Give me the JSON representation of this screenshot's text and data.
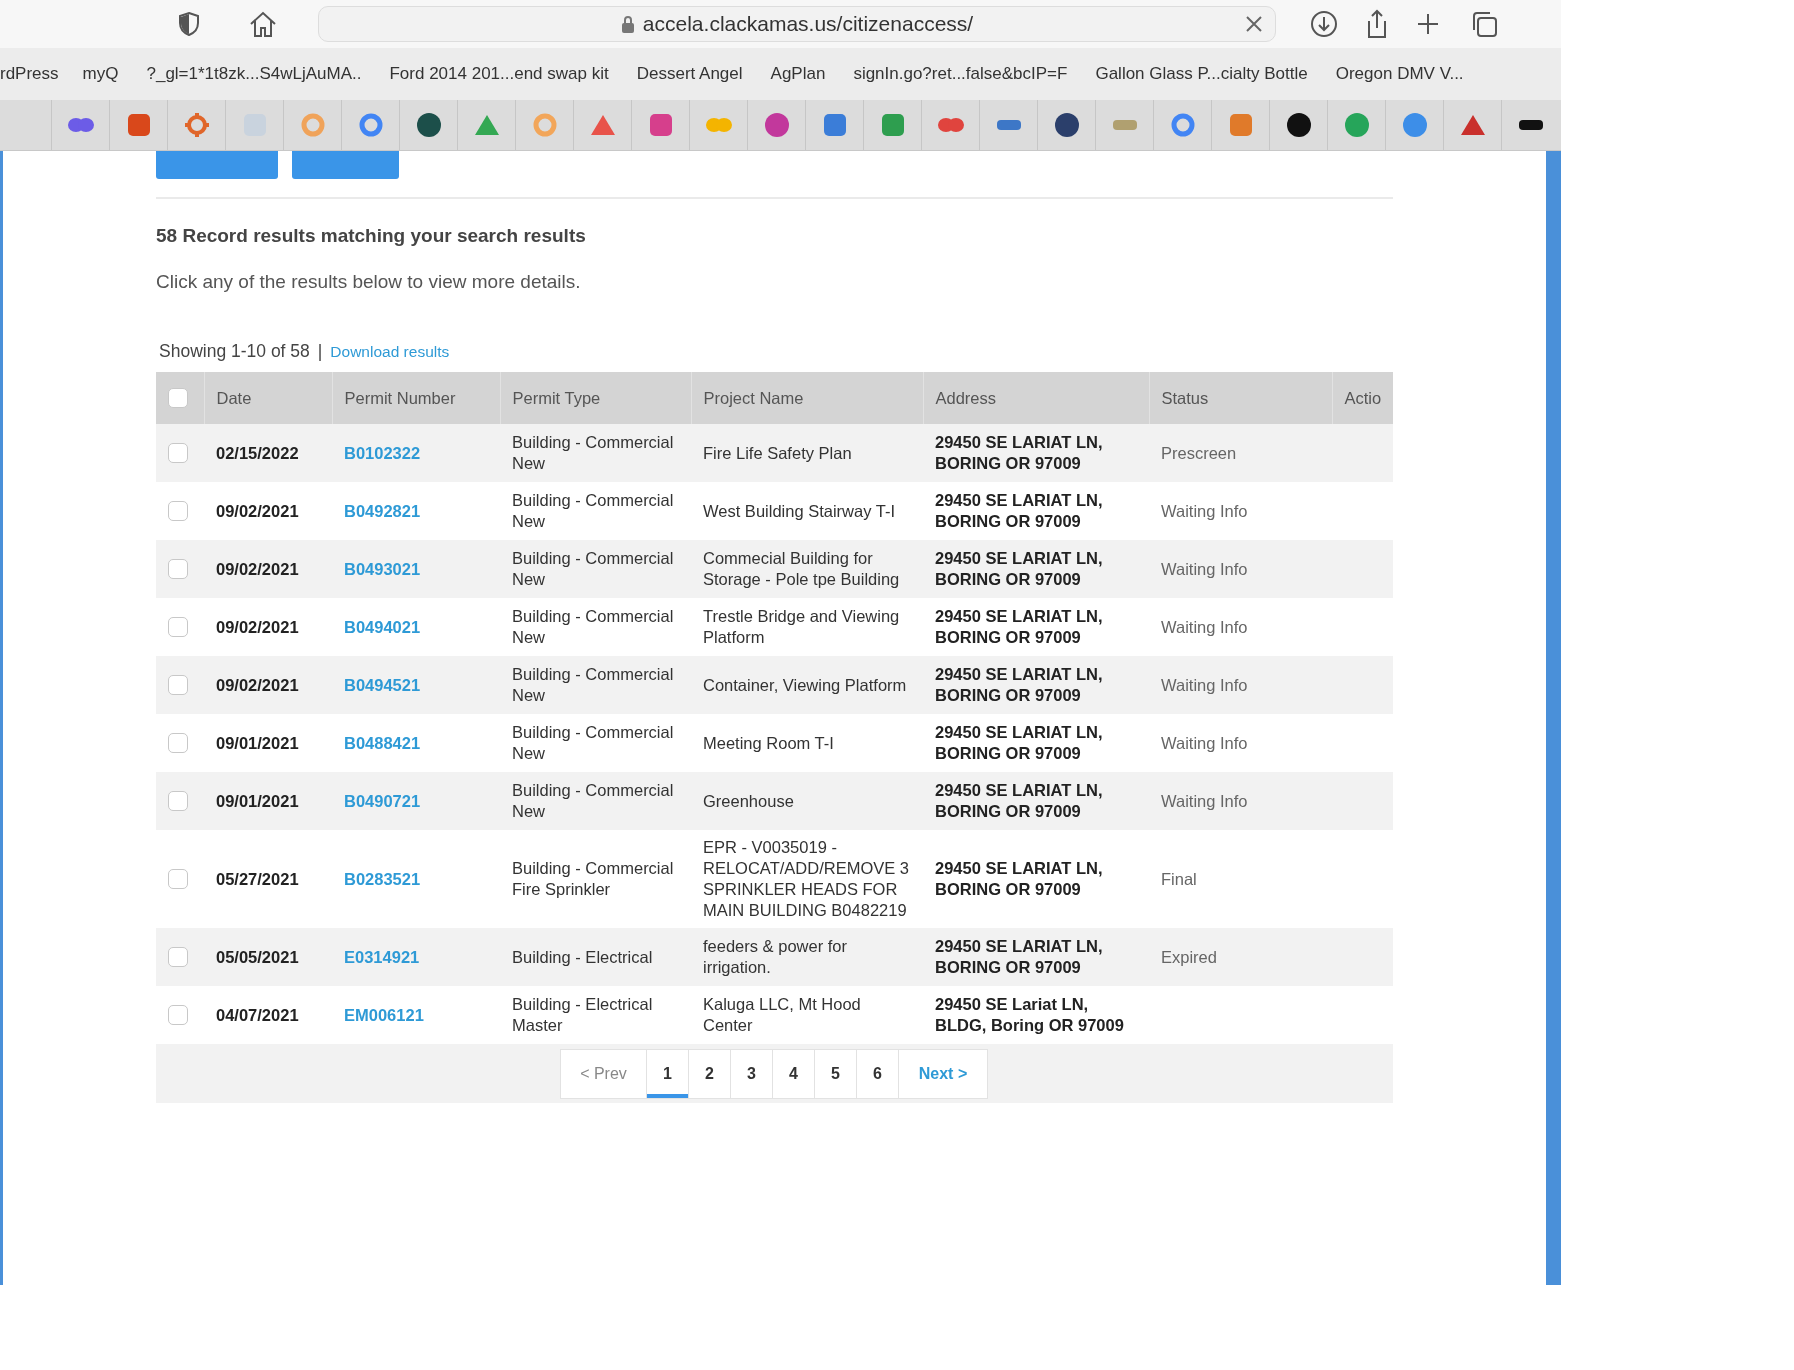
{
  "browser": {
    "url": "accela.clackamas.us/citizenaccess/",
    "bookmarks": [
      "rdPress",
      "myQ",
      "?_gl=1*1t8zk...S4wLjAuMA..",
      "Ford 2014 201...end swap kit",
      "Dessert Angel",
      "AgPlan",
      "signIn.go?ret...false&bcIP=F",
      "Gallon Glass P...cialty Bottle",
      "Oregon DMV V..."
    ]
  },
  "results": {
    "summary": "58 Record results matching your search results",
    "hint": "Click any of the results below to view more details.",
    "showing": "Showing 1-10 of 58",
    "separator": "|",
    "download_link": "Download results"
  },
  "table": {
    "select_all_checked": false,
    "columns": [
      "Date",
      "Permit Number",
      "Permit Type",
      "Project Name",
      "Address",
      "Status",
      "Actio"
    ],
    "rows": [
      {
        "checked": false,
        "date": "02/15/2022",
        "permit_number": "B0102322",
        "permit_type": "Building - Commercial New",
        "project_name": "Fire Life Safety Plan",
        "address": "29450 SE LARIAT LN, BORING OR 97009",
        "status": "Prescreen"
      },
      {
        "checked": false,
        "date": "09/02/2021",
        "permit_number": "B0492821",
        "permit_type": "Building - Commercial New",
        "project_name": "West Building Stairway T-I",
        "address": "29450 SE LARIAT LN, BORING OR 97009",
        "status": "Waiting Info"
      },
      {
        "checked": false,
        "date": "09/02/2021",
        "permit_number": "B0493021",
        "permit_type": "Building - Commercial New",
        "project_name": "Commecial Building for Storage - Pole tpe Building",
        "address": "29450 SE LARIAT LN, BORING OR 97009",
        "status": "Waiting Info"
      },
      {
        "checked": false,
        "date": "09/02/2021",
        "permit_number": "B0494021",
        "permit_type": "Building - Commercial New",
        "project_name": "Trestle Bridge and Viewing Platform",
        "address": "29450 SE LARIAT LN, BORING OR 97009",
        "status": "Waiting Info"
      },
      {
        "checked": false,
        "date": "09/02/2021",
        "permit_number": "B0494521",
        "permit_type": "Building - Commercial New",
        "project_name": "Container, Viewing Platform",
        "address": "29450 SE LARIAT LN, BORING OR 97009",
        "status": "Waiting Info"
      },
      {
        "checked": false,
        "date": "09/01/2021",
        "permit_number": "B0488421",
        "permit_type": "Building - Commercial New",
        "project_name": "Meeting Room T-I",
        "address": "29450 SE LARIAT LN, BORING OR 97009",
        "status": "Waiting Info"
      },
      {
        "checked": false,
        "date": "09/01/2021",
        "permit_number": "B0490721",
        "permit_type": "Building - Commercial New",
        "project_name": "Greenhouse",
        "address": "29450 SE LARIAT LN, BORING OR 97009",
        "status": "Waiting Info"
      },
      {
        "checked": false,
        "date": "05/27/2021",
        "permit_number": "B0283521",
        "permit_type": "Building - Commercial Fire Sprinkler",
        "project_name": "EPR - V0035019 - RELOCAT/ADD/REMOVE 3 SPRINKLER HEADS FOR MAIN BUILDING B0482219",
        "address": "29450 SE LARIAT LN, BORING OR 97009",
        "status": "Final"
      },
      {
        "checked": false,
        "date": "05/05/2021",
        "permit_number": "E0314921",
        "permit_type": "Building - Electrical",
        "project_name": "feeders & power for irrigation.",
        "address": "29450 SE LARIAT LN, BORING OR 97009",
        "status": "Expired"
      },
      {
        "checked": false,
        "date": "04/07/2021",
        "permit_number": "EM006121",
        "permit_type": "Building - Electrical Master",
        "project_name": "Kaluga LLC, Mt Hood Center",
        "address": "29450 SE Lariat LN, BLDG, Boring OR 97009"
      }
    ]
  },
  "pagination": {
    "prev": "< Prev",
    "prev_disabled": true,
    "pages": [
      {
        "label": "1",
        "selected": true
      },
      {
        "label": "2",
        "selected": false
      },
      {
        "label": "3",
        "selected": false
      },
      {
        "label": "4",
        "selected": false
      },
      {
        "label": "5",
        "selected": false
      },
      {
        "label": "6",
        "selected": false
      }
    ],
    "next": "Next >"
  }
}
